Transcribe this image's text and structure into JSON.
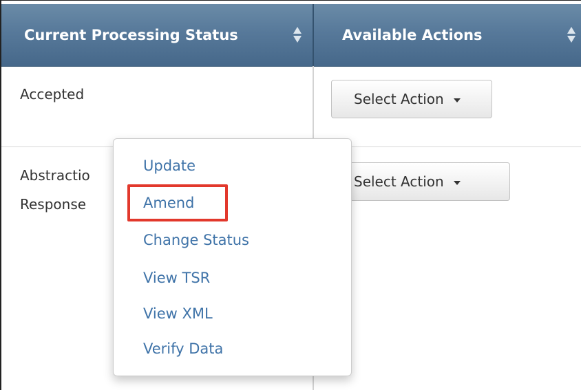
{
  "table": {
    "headers": [
      {
        "label": "Current Processing Status"
      },
      {
        "label": "Available Actions"
      }
    ],
    "rows": [
      {
        "status_lines": [
          "Accepted"
        ],
        "action_label": "Select Action"
      },
      {
        "status_lines": [
          "Abstractio",
          "Response"
        ],
        "action_label": "Select Action"
      }
    ]
  },
  "dropdown_menu": {
    "items": [
      "Update",
      "Amend",
      "Change Status",
      "View TSR",
      "View XML",
      "Verify Data"
    ],
    "highlighted_item": "Amend",
    "link_color": "#3f73a8"
  },
  "colors": {
    "header_bg": "#57799a",
    "highlight_border": "#e2382c"
  },
  "icons": {
    "sort": "sort-updown-icon",
    "caret": "caret-down-icon"
  }
}
